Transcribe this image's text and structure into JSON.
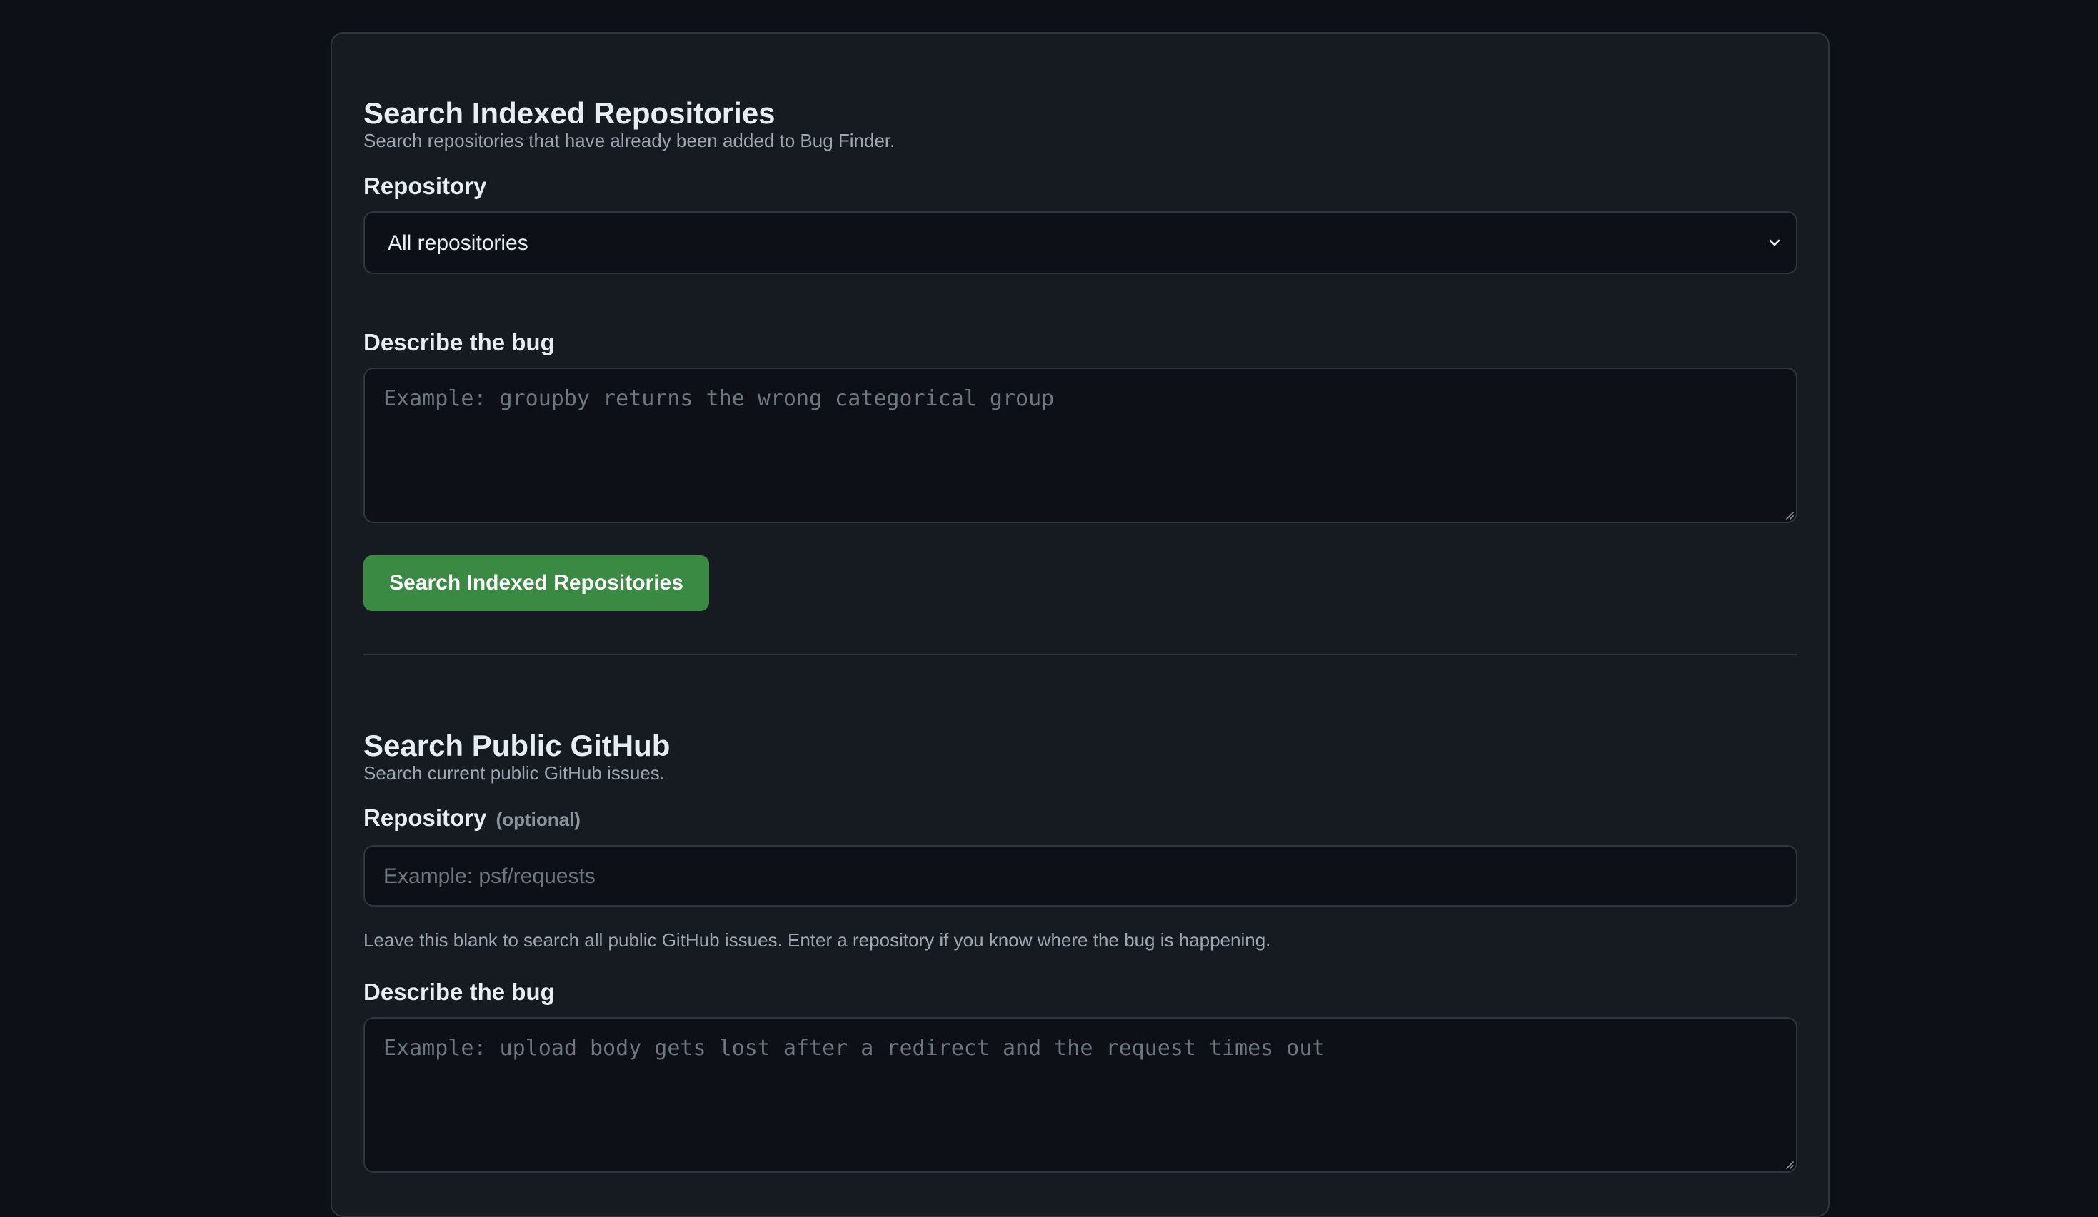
{
  "indexed": {
    "title": "Search Indexed Repositories",
    "description": "Search repositories that have already been added to Bug Finder.",
    "repository_label": "Repository",
    "repository_selected": "All repositories",
    "bug_label": "Describe the bug",
    "bug_placeholder": "Example: groupby returns the wrong categorical group",
    "button_label": "Search Indexed Repositories"
  },
  "github": {
    "title": "Search Public GitHub",
    "description": "Search current public GitHub issues.",
    "repository_label": "Repository",
    "repository_optional": "(optional)",
    "repository_placeholder": "Example: psf/requests",
    "repository_help": "Leave this blank to search all public GitHub issues. Enter a repository if you know where the bug is happening.",
    "bug_label": "Describe the bug",
    "bug_placeholder": "Example: upload body gets lost after a redirect and the request times out"
  },
  "colors": {
    "background": "#0d1117",
    "panel": "#161b22",
    "border": "#30363d",
    "button": "#3b8a44"
  },
  "icons": {
    "select_chevron": "chevron-down-icon",
    "resize": "resize-grip-icon"
  }
}
